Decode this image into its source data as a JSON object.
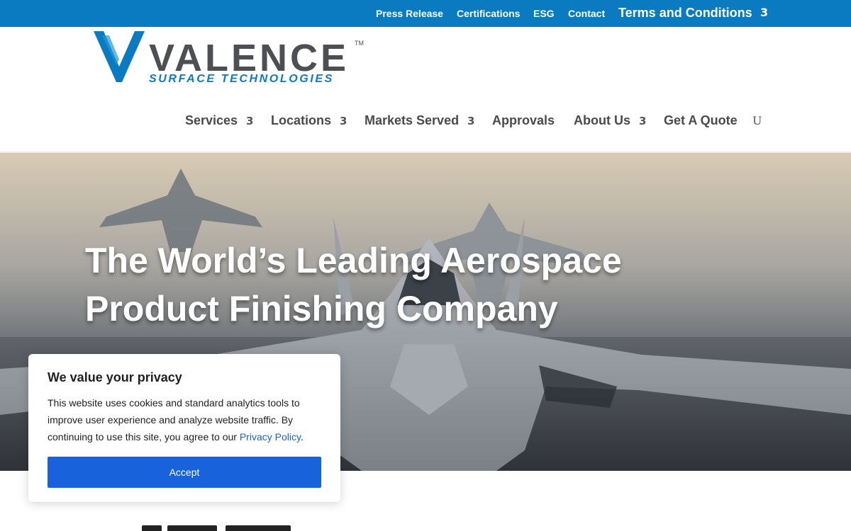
{
  "topbar": {
    "links": [
      "Press Release",
      "Certifications",
      "ESG",
      "Contact"
    ],
    "terms": "Terms and Conditions",
    "dropdown_glyph": "3"
  },
  "logo": {
    "name": "VALENCE",
    "tagline": "SURFACE TECHNOLOGIES",
    "tm": "TM",
    "brand_color": "#0b7bc1",
    "text_color": "#4d4f53"
  },
  "nav": {
    "services": "Services",
    "locations": "Locations",
    "markets": "Markets Served",
    "approvals": "Approvals",
    "about": "About Us",
    "quote": "Get A Quote",
    "caret": "3",
    "search_glyph": "U"
  },
  "hero": {
    "title": "The World’s Leading Aerospace Product Finishing Company"
  },
  "cookie": {
    "title": "We value your privacy",
    "text": "This website uses cookies and standard analytics tools to improve user experience and analyze website traffic. By continuing to use this site, you agree to our",
    "link": "Privacy Policy",
    "period": ".",
    "accept": "Accept",
    "accent": "#1863dc"
  }
}
